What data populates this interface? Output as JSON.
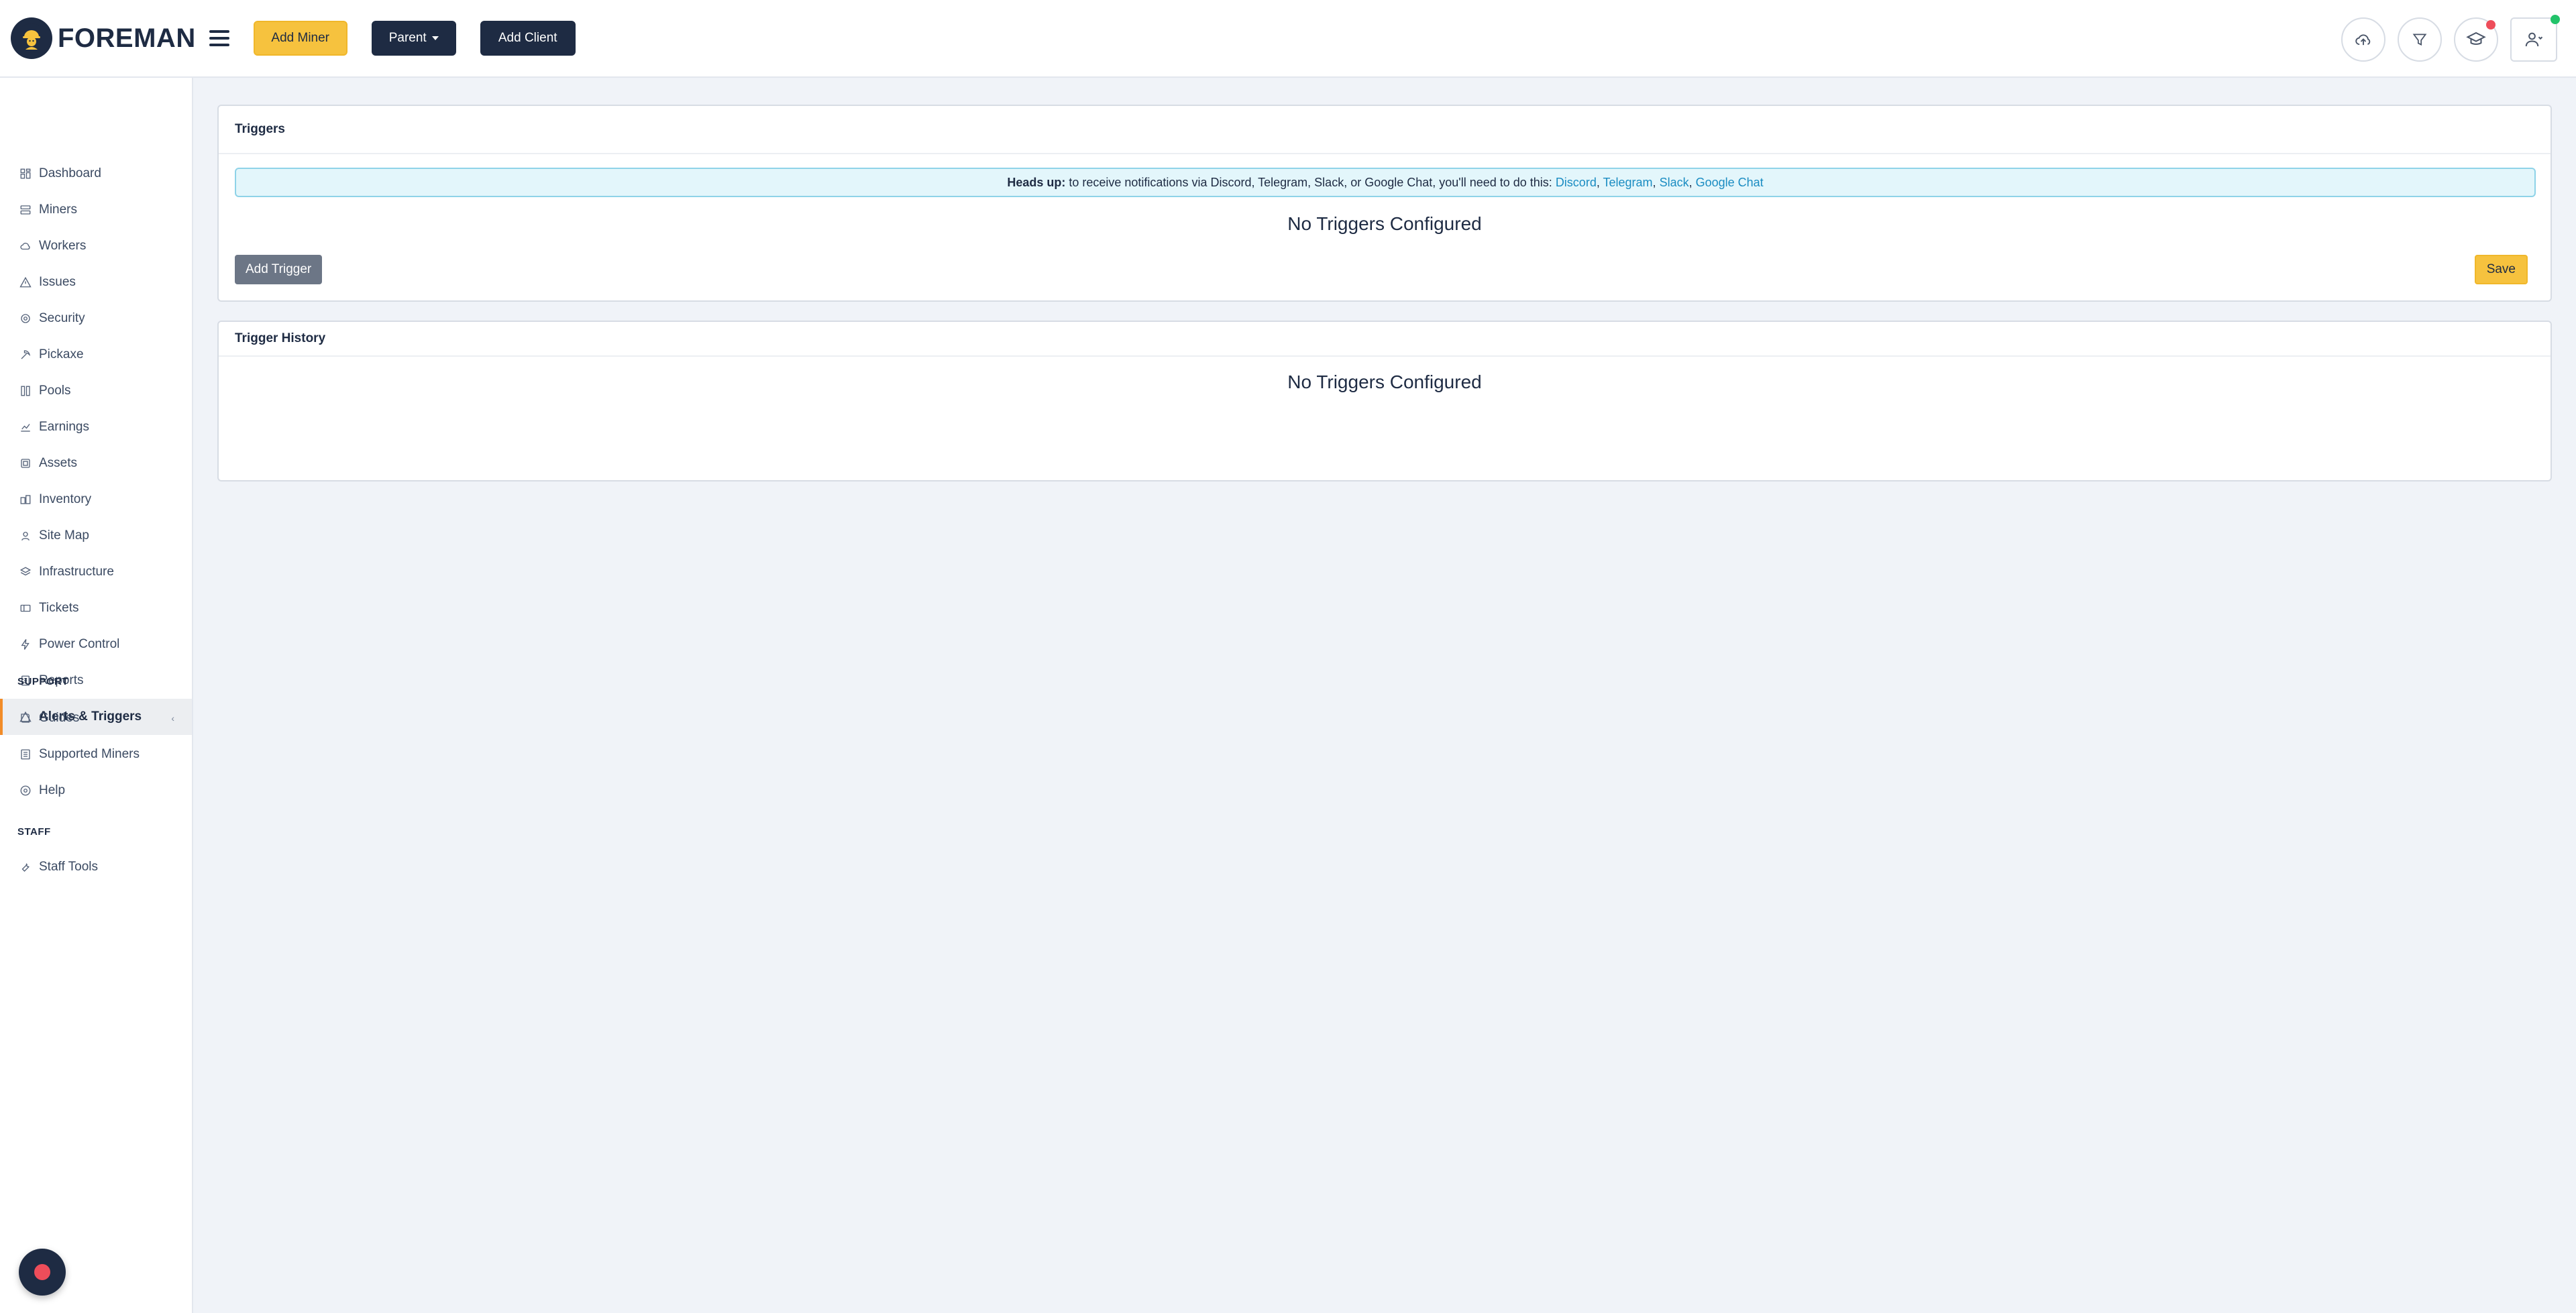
{
  "header": {
    "logo_text": "FOREMAN",
    "add_miner_label": "Add Miner",
    "parent_label": "Parent",
    "add_client_label": "Add Client"
  },
  "sidebar": {
    "items": [
      {
        "label": "Dashboard",
        "icon": "dashboard-icon"
      },
      {
        "label": "Miners",
        "icon": "server-icon"
      },
      {
        "label": "Workers",
        "icon": "cloud-icon"
      },
      {
        "label": "Issues",
        "icon": "warning-icon"
      },
      {
        "label": "Security",
        "icon": "shield-icon"
      },
      {
        "label": "Pickaxe",
        "icon": "pickaxe-icon"
      },
      {
        "label": "Pools",
        "icon": "pools-icon"
      },
      {
        "label": "Earnings",
        "icon": "earnings-icon"
      },
      {
        "label": "Assets",
        "icon": "assets-icon"
      },
      {
        "label": "Inventory",
        "icon": "inventory-icon"
      },
      {
        "label": "Site Map",
        "icon": "map-icon"
      },
      {
        "label": "Infrastructure",
        "icon": "layers-icon"
      },
      {
        "label": "Tickets",
        "icon": "ticket-icon"
      },
      {
        "label": "Power Control",
        "icon": "bolt-icon"
      },
      {
        "label": "Reports",
        "icon": "report-icon"
      },
      {
        "label": "Alerts & Triggers",
        "icon": "alert-icon",
        "active": true
      }
    ],
    "support_title": "SUPPORT",
    "support_items": [
      {
        "label": "Guides",
        "icon": "book-icon"
      },
      {
        "label": "Supported Miners",
        "icon": "list-icon"
      },
      {
        "label": "Help",
        "icon": "help-icon"
      }
    ],
    "staff_title": "STAFF",
    "staff_items": [
      {
        "label": "Staff Tools",
        "icon": "tools-icon"
      }
    ]
  },
  "triggers_card": {
    "title": "Triggers",
    "alert_prefix": "Heads up:",
    "alert_text": " to receive notifications via Discord, Telegram, Slack, or Google Chat, you'll need to do this: ",
    "links": [
      "Discord",
      "Telegram",
      "Slack",
      "Google Chat"
    ],
    "empty_text": "No Triggers Configured",
    "add_trigger_label": "Add Trigger",
    "save_label": "Save"
  },
  "history_card": {
    "title": "Trigger History",
    "empty_text": "No Triggers Configured"
  },
  "colors": {
    "navy": "#1e2b43",
    "yellow": "#f6c23e",
    "accent_orange": "#f28c28",
    "link_blue": "#1a8cc2",
    "alert_bg": "#e3f6fb"
  }
}
